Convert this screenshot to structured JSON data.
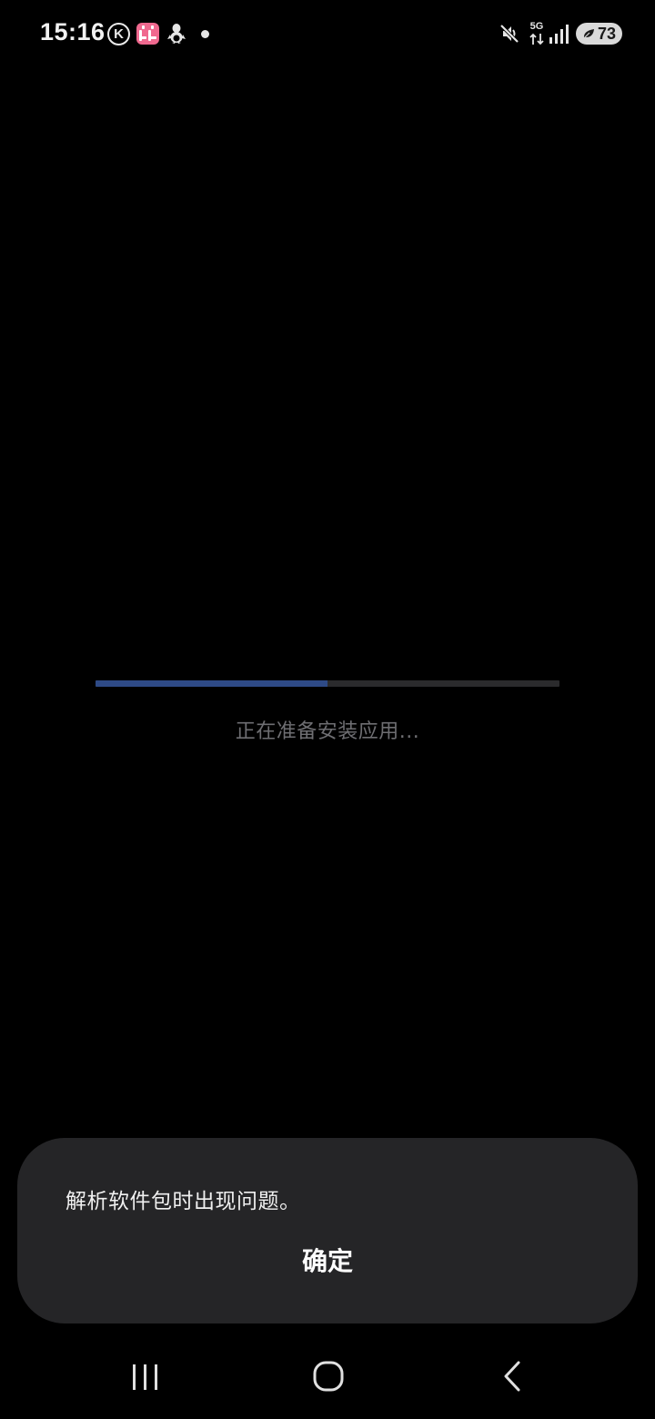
{
  "status_bar": {
    "time": "15:16",
    "k_icon_letter": "K",
    "network_type": "5G",
    "battery_level": "73",
    "icons": [
      "k-circle-icon",
      "bilibili-icon",
      "penguin-icon",
      "notification-dot-icon",
      "mute-icon",
      "5g-data-icon",
      "signal-icon",
      "battery-saver-leaf-icon"
    ]
  },
  "install": {
    "status_text": "正在准备安装应用...",
    "progress_fraction": 0.5
  },
  "dialog": {
    "message": "解析软件包时出现问题。",
    "ok_label": "确定"
  },
  "navigation": {
    "icons": [
      "recent-apps-icon",
      "home-icon",
      "back-icon"
    ]
  },
  "colors": {
    "background": "#000000",
    "progress_fill": "#2e4a86",
    "progress_track": "#2b2b2d",
    "dialog_background": "#252527",
    "status_text": "#6e6e72"
  }
}
